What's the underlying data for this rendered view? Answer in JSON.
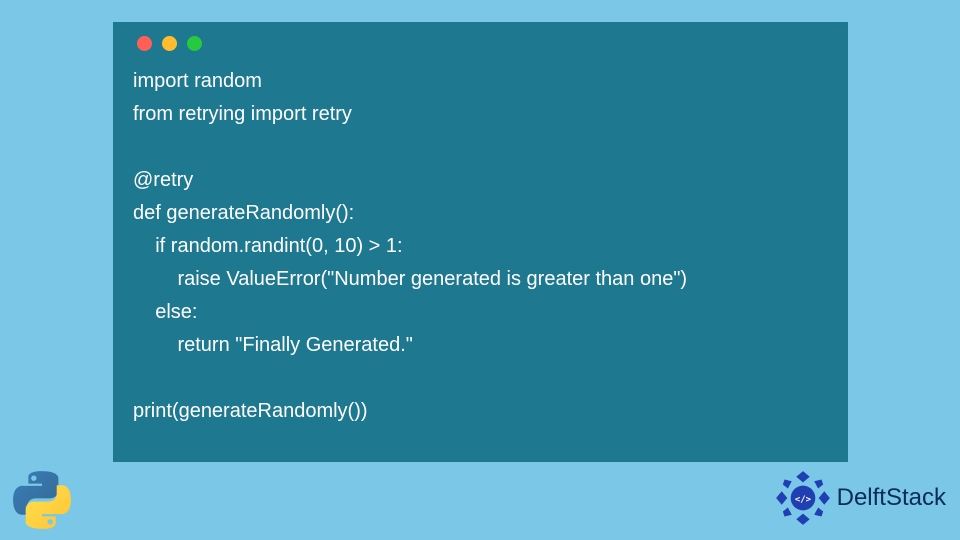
{
  "code": {
    "lines": [
      "import random",
      "from retrying import retry",
      "",
      "@retry",
      "def generateRandomly():",
      "    if random.randint(0, 10) > 1:",
      "        raise ValueError(\"Number generated is greater than one\")",
      "    else:",
      "        return \"Finally Generated.\"",
      "",
      "print(generateRandomly())"
    ]
  },
  "brand": {
    "name": "DelftStack"
  },
  "window": {
    "dots": [
      "red",
      "yellow",
      "green"
    ]
  }
}
